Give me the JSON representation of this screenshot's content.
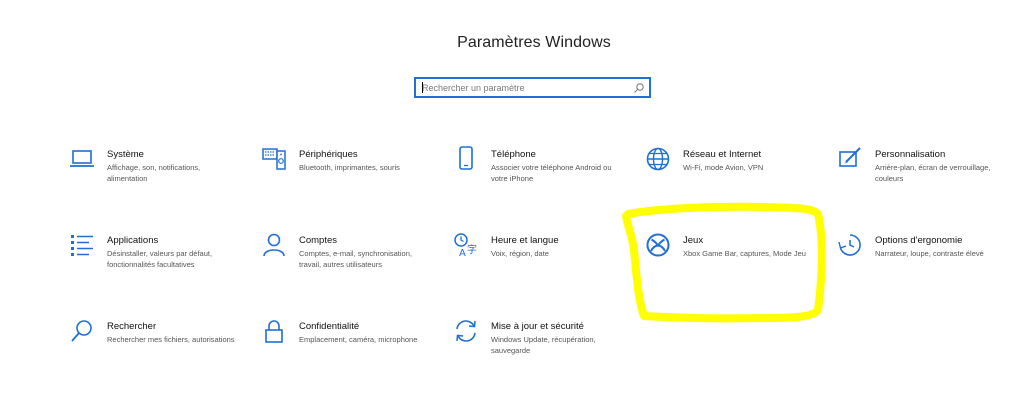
{
  "window": {
    "title": "Paramètres Windows"
  },
  "search": {
    "placeholder": "Rechercher un paramètre",
    "icon": "search-icon"
  },
  "accent": "#1f6fd6",
  "highlight_color": "#ffff00",
  "categories": [
    {
      "name": "Système",
      "desc": "Affichage, son, notifications, alimentation",
      "icon": "laptop-icon"
    },
    {
      "name": "Périphériques",
      "desc": "Bluetooth, imprimantes, souris",
      "icon": "devices-icon"
    },
    {
      "name": "Téléphone",
      "desc": "Associer votre téléphone Android ou votre iPhone",
      "icon": "phone-icon"
    },
    {
      "name": "Réseau et Internet",
      "desc": "Wi-Fi, mode Avion, VPN",
      "icon": "globe-icon"
    },
    {
      "name": "Personnalisation",
      "desc": "Arrière-plan, écran de verrouillage, couleurs",
      "icon": "paint-icon"
    },
    {
      "name": "Applications",
      "desc": "Désinstaller, valeurs par défaut, fonctionnalités facultatives",
      "icon": "apps-list-icon"
    },
    {
      "name": "Comptes",
      "desc": "Comptes, e-mail, synchronisation, travail, autres utilisateurs",
      "icon": "person-icon"
    },
    {
      "name": "Heure et langue",
      "desc": "Voix, région, date",
      "icon": "time-language-icon"
    },
    {
      "name": "Jeux",
      "desc": "Xbox Game Bar, captures, Mode Jeu",
      "icon": "xbox-icon"
    },
    {
      "name": "Options d'ergonomie",
      "desc": "Narrateur, loupe, contraste élevé",
      "icon": "ease-of-access-icon"
    },
    {
      "name": "Rechercher",
      "desc": "Rechercher mes fichiers, autorisations",
      "icon": "search-icon"
    },
    {
      "name": "Confidentialité",
      "desc": "Emplacement, caméra, microphone",
      "icon": "lock-icon"
    },
    {
      "name": "Mise à jour et sécurité",
      "desc": "Windows Update, récupération, sauvegarde",
      "icon": "sync-icon"
    }
  ]
}
